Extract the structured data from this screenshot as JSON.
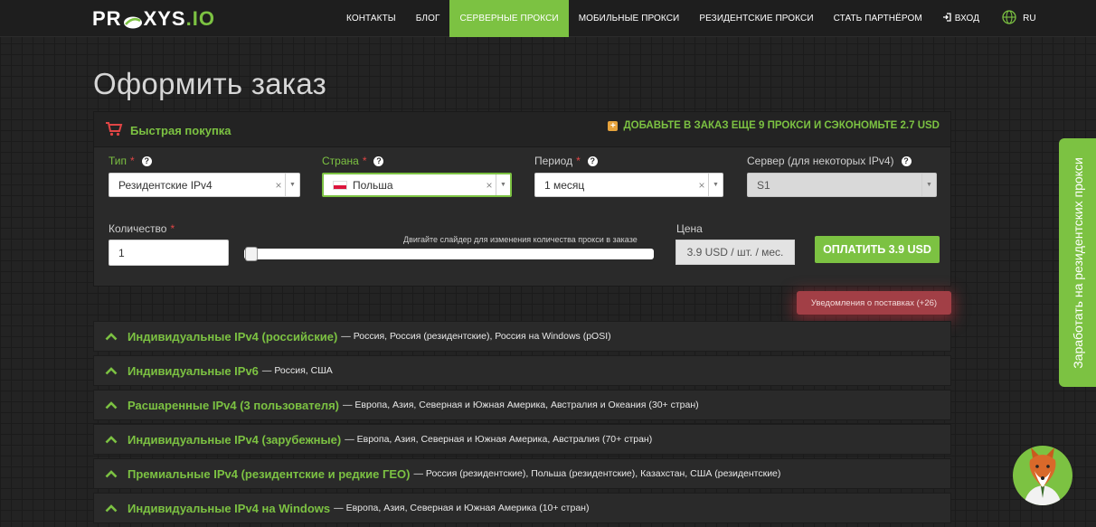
{
  "brand": {
    "logo_left": "PR",
    "logo_right": "XYS",
    "logo_suffix": ".IO"
  },
  "nav": {
    "items": [
      {
        "label": "КОНТАКТЫ"
      },
      {
        "label": "БЛОГ"
      },
      {
        "label": "СЕРВЕРНЫЕ ПРОКСИ"
      },
      {
        "label": "МОБИЛЬНЫЕ ПРОКСИ"
      },
      {
        "label": "РЕЗИДЕНТСКИЕ ПРОКСИ"
      },
      {
        "label": "СТАТЬ ПАРТНЁРОМ"
      }
    ],
    "login": "ВХОД",
    "lang": "RU",
    "active_color": "#7cc242"
  },
  "page": {
    "title": "Оформить заказ"
  },
  "order": {
    "panel_title": "Быстрая покупка",
    "promo": "ДОБАВЬТЕ В ЗАКАЗ ЕЩЕ 9 ПРОКСИ И СЭКОНОМЬТЕ 2.7 USD",
    "type": {
      "label": "Тип",
      "value": "Резидентские IPv4"
    },
    "country": {
      "label": "Страна",
      "value": "Польша"
    },
    "period": {
      "label": "Период",
      "value": "1 месяц"
    },
    "server": {
      "label": "Сервер (для некоторых IPv4)",
      "value": "S1"
    },
    "quantity": {
      "label": "Количество",
      "value": "1"
    },
    "slider_hint": "Двигайте слайдер для изменения количества прокси в заказе",
    "slider_fraction": 0.0,
    "price": {
      "label": "Цена",
      "value": "3.9 USD / шт. / мес."
    },
    "pay_button": "ОПЛАТИТЬ 3.9 USD",
    "required_mark": "*"
  },
  "notification": "Уведомления о поставках (+26)",
  "categories": [
    {
      "title": "Индивидуальные IPv4 (российские)",
      "desc": "— Россия, Россия (резидентские), Россия на Windows (pOSI)"
    },
    {
      "title": "Индивидуальные IPv6",
      "desc": "— Россия, США"
    },
    {
      "title": "Расшаренные IPv4 (3 пользователя)",
      "desc": "— Европа, Азия, Северная и Южная Америка, Австралия и Океания (30+ стран)"
    },
    {
      "title": "Индивидуальные IPv4 (зарубежные)",
      "desc": "— Европа, Азия, Северная и Южная Америка, Австралия (70+ стран)"
    },
    {
      "title": "Премиальные IPv4 (резидентские и редкие ГЕО)",
      "desc": "— Россия (резидентские), Польша (резидентские), Казахстан, США (резидентские)"
    },
    {
      "title": "Индивидуальные IPv4 на Windows",
      "desc": "— Европа, Азия, Северная и Южная Америка (10+ стран)"
    }
  ],
  "side_tab": "Заработать на резидентских прокси",
  "colors": {
    "accent": "#7cc242",
    "background": "#232323",
    "panel": "#2a2a2a",
    "notify": "#a23f46",
    "required": "#e04545"
  }
}
